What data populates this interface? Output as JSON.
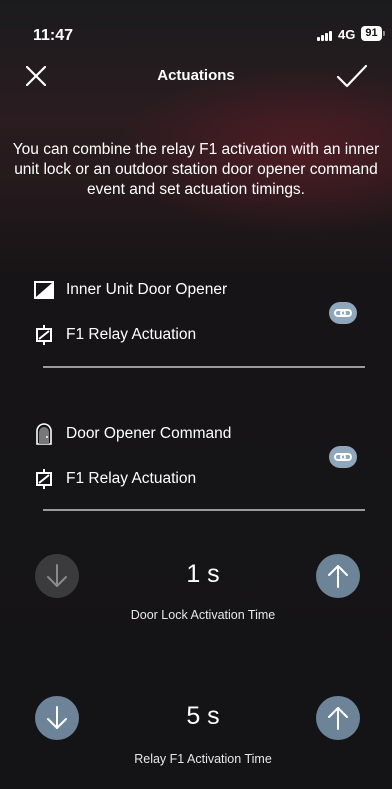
{
  "status_bar": {
    "time": "11:47",
    "network": "4G",
    "battery": "91"
  },
  "nav": {
    "title": "Actuations",
    "close_icon": "close-icon",
    "confirm_icon": "checkmark-icon"
  },
  "description": "You can combine the relay F1 activation with an inner unit lock or an outdoor station door opener command event and set actuation timings.",
  "pairs": [
    {
      "source_label": "Inner Unit Door Opener",
      "source_icon": "inner-unit-icon",
      "relay_label": "F1 Relay Actuation",
      "relay_icon": "relay-icon",
      "link_icon": "link-icon"
    },
    {
      "source_label": "Door Opener Command",
      "source_icon": "door-icon",
      "relay_label": "F1 Relay Actuation",
      "relay_icon": "relay-icon",
      "link_icon": "link-icon"
    }
  ],
  "steppers": [
    {
      "value": "1 s",
      "caption": "Door Lock Activation Time",
      "decrease_enabled": false,
      "increase_enabled": true
    },
    {
      "value": "5 s",
      "caption": "Relay F1 Activation Time",
      "decrease_enabled": true,
      "increase_enabled": true
    }
  ],
  "colors": {
    "accent": "#6d8397",
    "link_badge": "#8fa6bb",
    "disabled": "#3b3b3d"
  }
}
